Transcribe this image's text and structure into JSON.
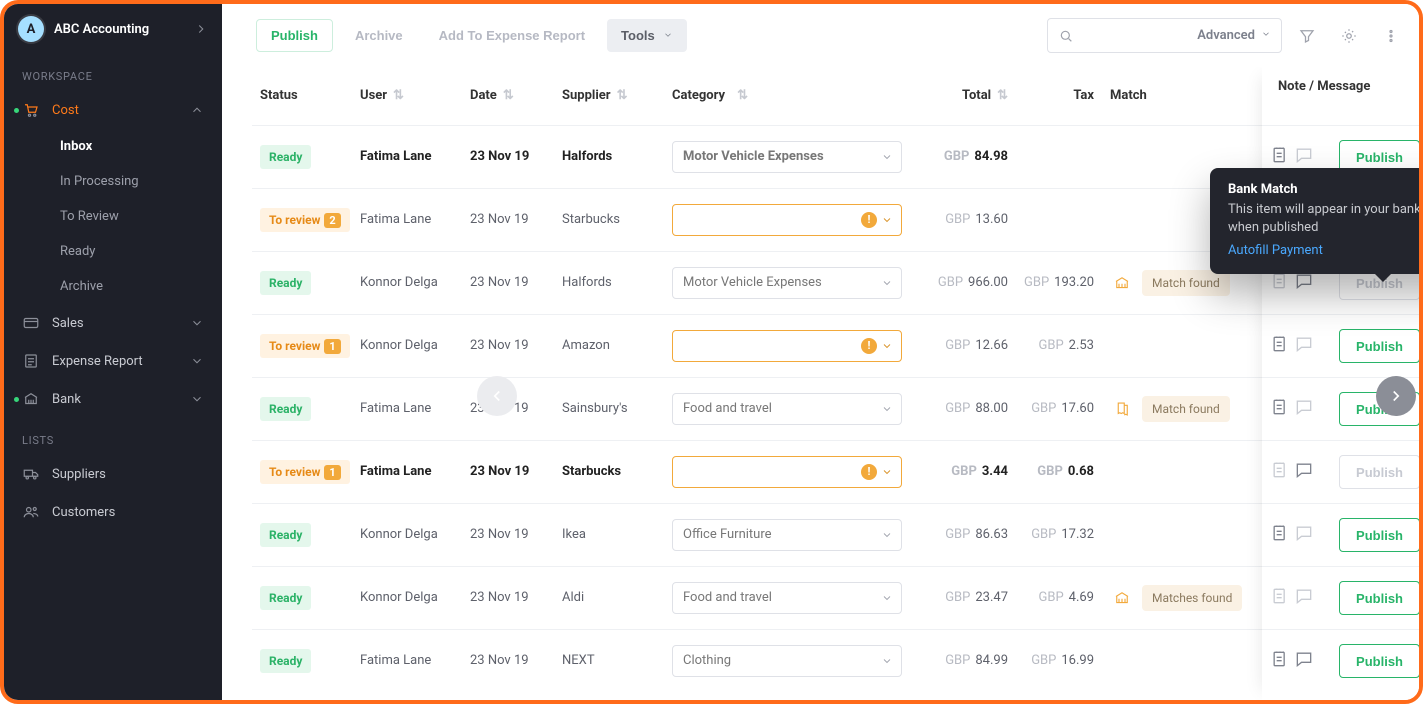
{
  "sidebar": {
    "account_letter": "A",
    "account_name": "ABC Accounting",
    "section_workspace": "WORKSPACE",
    "section_lists": "LISTS",
    "cost": "Cost",
    "sales": "Sales",
    "expense_report": "Expense Report",
    "bank": "Bank",
    "suppliers": "Suppliers",
    "customers": "Customers",
    "cost_children": {
      "inbox": "Inbox",
      "in_processing": "In Processing",
      "to_review": "To Review",
      "ready": "Ready",
      "archive": "Archive"
    }
  },
  "toolbar": {
    "publish": "Publish",
    "archive": "Archive",
    "add_to_expense": "Add To Expense Report",
    "tools": "Tools",
    "advanced": "Advanced"
  },
  "columns": {
    "status": "Status",
    "user": "User",
    "date": "Date",
    "supplier": "Supplier",
    "category": "Category",
    "total": "Total",
    "tax": "Tax",
    "match": "Match",
    "note": "Note / Message"
  },
  "labels": {
    "ready": "Ready",
    "to_review": "To review",
    "match_found": "Match found",
    "matches_found": "Matches found",
    "publish_btn": "Publish"
  },
  "tooltip": {
    "title": "Bank Match",
    "body": "This item will appear in your bank reconciliation feed when published",
    "link": "Autofill Payment"
  },
  "rows": [
    {
      "status": "ready",
      "status_count": null,
      "bold": true,
      "user": "Fatima Lane",
      "date": "23 Nov 19",
      "supplier": "Halfords",
      "category": "Motor Vehicle Expenses",
      "cat_warn": false,
      "total_cur": "GBP",
      "total": "84.98",
      "tax_cur": "",
      "tax": "",
      "match": "",
      "publish_enabled": true,
      "note": true,
      "msg": false
    },
    {
      "status": "review",
      "status_count": "2",
      "bold": false,
      "user": "Fatima Lane",
      "date": "23 Nov 19",
      "supplier": "Starbucks",
      "category": "",
      "cat_warn": true,
      "total_cur": "GBP",
      "total": "13.60",
      "tax_cur": "",
      "tax": "",
      "match": "",
      "publish_enabled": false,
      "note": false,
      "msg": false
    },
    {
      "status": "ready",
      "status_count": null,
      "bold": false,
      "user": "Konnor Delga",
      "date": "23 Nov 19",
      "supplier": "Halfords",
      "category": "Motor Vehicle Expenses",
      "cat_warn": false,
      "total_cur": "GBP",
      "total": "966.00",
      "tax_cur": "GBP",
      "tax": "193.20",
      "match": "Match found",
      "match_type": "bank",
      "publish_enabled": false,
      "note": false,
      "msg": true
    },
    {
      "status": "review",
      "status_count": "1",
      "bold": false,
      "user": "Konnor Delga",
      "date": "23 Nov 19",
      "supplier": "Amazon",
      "category": "",
      "cat_warn": true,
      "total_cur": "GBP",
      "total": "12.66",
      "tax_cur": "GBP",
      "tax": "2.53",
      "match": "",
      "publish_enabled": true,
      "note": true,
      "msg": false
    },
    {
      "status": "ready",
      "status_count": null,
      "bold": false,
      "user": "Fatima Lane",
      "date": "23 Nov 19",
      "supplier": "Sainsbury's",
      "category": "Food and travel",
      "cat_warn": false,
      "total_cur": "GBP",
      "total": "88.00",
      "tax_cur": "GBP",
      "tax": "17.60",
      "match": "Match found",
      "match_type": "receipt",
      "publish_enabled": true,
      "note": true,
      "msg": false
    },
    {
      "status": "review",
      "status_count": "1",
      "bold": true,
      "user": "Fatima Lane",
      "date": "23 Nov 19",
      "supplier": "Starbucks",
      "category": "",
      "cat_warn": true,
      "total_cur": "GBP",
      "total": "3.44",
      "tax_cur": "GBP",
      "tax": "0.68",
      "match": "",
      "publish_enabled": false,
      "note": false,
      "msg": true
    },
    {
      "status": "ready",
      "status_count": null,
      "bold": false,
      "user": "Konnor Delga",
      "date": "23 Nov 19",
      "supplier": "Ikea",
      "category": "Office Furniture",
      "cat_warn": false,
      "total_cur": "GBP",
      "total": "86.63",
      "tax_cur": "GBP",
      "tax": "17.32",
      "match": "",
      "publish_enabled": true,
      "note": true,
      "msg": false
    },
    {
      "status": "ready",
      "status_count": null,
      "bold": false,
      "user": "Konnor Delga",
      "date": "23 Nov 19",
      "supplier": "Aldi",
      "category": "Food and travel",
      "cat_warn": false,
      "total_cur": "GBP",
      "total": "23.47",
      "tax_cur": "GBP",
      "tax": "4.69",
      "match": "Matches found",
      "match_type": "bank",
      "publish_enabled": true,
      "note": false,
      "msg": false
    },
    {
      "status": "ready",
      "status_count": null,
      "bold": false,
      "user": "Fatima Lane",
      "date": "23 Nov 19",
      "supplier": "NEXT",
      "category": "Clothing",
      "cat_warn": false,
      "total_cur": "GBP",
      "total": "84.99",
      "tax_cur": "GBP",
      "tax": "16.99",
      "match": "",
      "publish_enabled": true,
      "note": true,
      "msg": true
    }
  ]
}
